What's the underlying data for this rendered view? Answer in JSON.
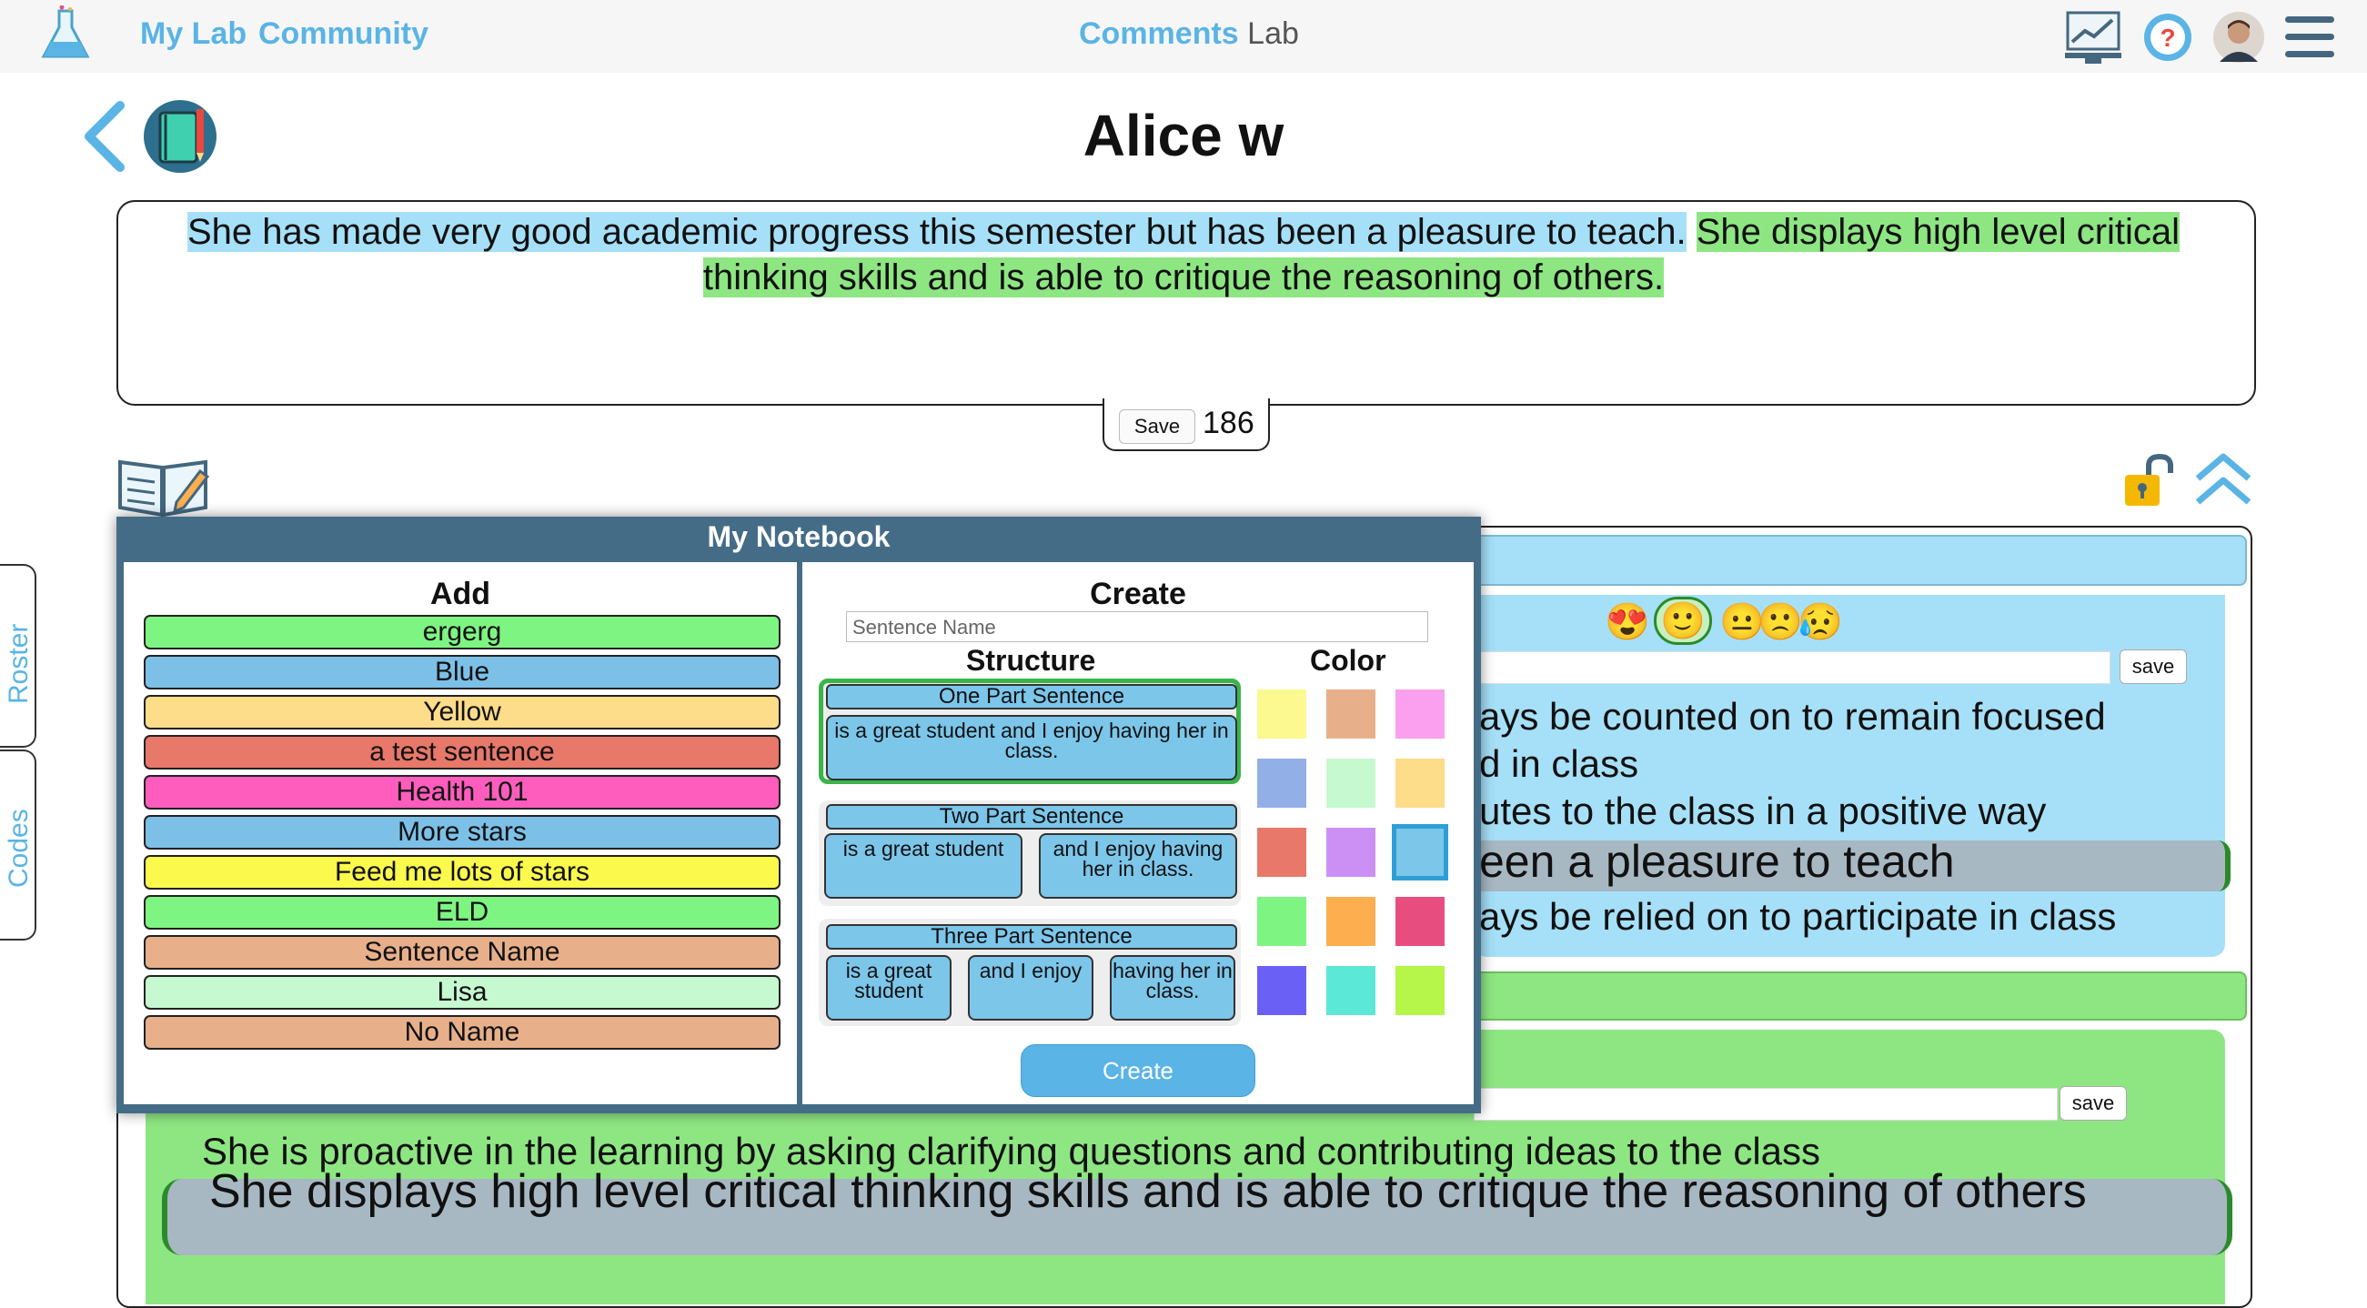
{
  "header": {
    "nav": [
      "My Lab",
      "Community"
    ],
    "app_title_bold": "Comments",
    "app_title_rest": "Lab",
    "icons": [
      "flask-logo-icon",
      "chart-monitor-icon",
      "help-icon",
      "avatar",
      "menu-icon"
    ]
  },
  "student": {
    "name": "Alice w"
  },
  "comment": {
    "sentence_1": "She has made very good academic progress this semester but has been a pleasure to teach.",
    "sentence_2": "She displays high level critical thinking skills and is able to critique the reasoning of others.",
    "save_label": "Save",
    "char_count": "186"
  },
  "side_tabs": [
    "Roster",
    "Codes"
  ],
  "blue_section": {
    "save_label": "save",
    "lines": [
      "ays be counted on to remain focused",
      "d in class",
      "utes to the class in a positive way",
      "een a pleasure to teach",
      "ays be relied on to participate in class"
    ],
    "emojis": [
      "😍",
      "🙂",
      "😐",
      "🙁",
      "😥"
    ]
  },
  "green_section": {
    "save_label": "save",
    "line_1": "She is proactive in the learning by asking clarifying questions and contributing ideas to the class",
    "line_2": "She displays high level critical thinking skills and is able to critique the reasoning of others"
  },
  "notebook": {
    "title": "My Notebook",
    "add_heading": "Add",
    "create_heading": "Create",
    "sentence_name_placeholder": "Sentence Name",
    "structure_heading": "Structure",
    "color_heading": "Color",
    "add_items": [
      {
        "label": "ergerg",
        "color": "#7ef582"
      },
      {
        "label": "Blue",
        "color": "#7cc0e8"
      },
      {
        "label": "Yellow",
        "color": "#fddc8a"
      },
      {
        "label": "a test sentence",
        "color": "#e8786a"
      },
      {
        "label": "Health 101",
        "color": "#ff5dbd"
      },
      {
        "label": "More stars",
        "color": "#7cc0e8"
      },
      {
        "label": "Feed me lots of stars",
        "color": "#fbf94c"
      },
      {
        "label": "ELD",
        "color": "#7ef582"
      },
      {
        "label": "Sentence Name",
        "color": "#e8b08a"
      },
      {
        "label": "Lisa",
        "color": "#c6f9d0"
      },
      {
        "label": "No Name",
        "color": "#e8b08a"
      }
    ],
    "structures": {
      "one_title": "One Part Sentence",
      "one_parts": [
        "is a great student and I enjoy having her in class."
      ],
      "two_title": "Two Part Sentence",
      "two_parts": [
        "is a great student",
        "and I enjoy having her in class."
      ],
      "three_title": "Three Part Sentence",
      "three_parts": [
        "is a great student",
        "and I enjoy",
        "having her in class."
      ]
    },
    "colors": [
      "#fbf98f",
      "#e8b08a",
      "#fba0ee",
      "#93afe8",
      "#c6f9d0",
      "#fddc8a",
      "#e8786a",
      "#cc90f5",
      "#7cc6ea",
      "#7ef582",
      "#fdae4e",
      "#e84d7f",
      "#6a60f5",
      "#5ce8d6",
      "#b6f54a"
    ],
    "selected_color": "#7cc6ea",
    "create_label": "Create"
  }
}
